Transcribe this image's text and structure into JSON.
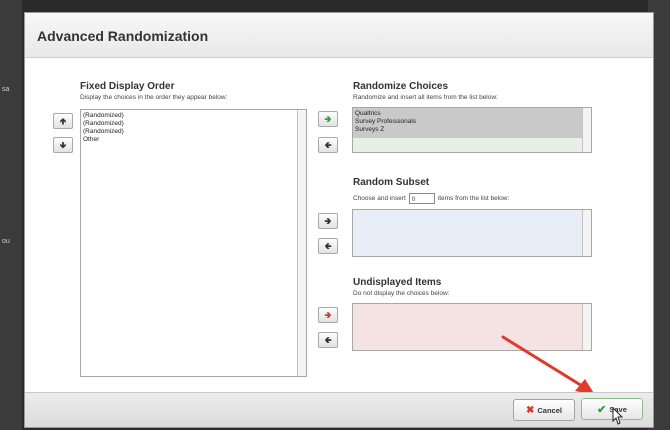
{
  "dialog": {
    "title": "Advanced Randomization"
  },
  "fixed": {
    "title": "Fixed Display Order",
    "description": "Display the choices in the order they appear below:",
    "items": [
      "(Randomized)",
      "(Randomized)",
      "(Randomized)",
      "Other"
    ]
  },
  "randomize": {
    "title": "Randomize Choices",
    "description": "Randomize and insert all items from the list below:",
    "items": [
      "Qualtrics",
      "Survey Professionals",
      "Surveys Z"
    ]
  },
  "subset": {
    "title": "Random Subset",
    "description_prefix": "Choose and insert",
    "count_value": "0",
    "description_suffix": "items from the list below:"
  },
  "undisplayed": {
    "title": "Undisplayed Items",
    "description": "Do not display the choices below:"
  },
  "footer": {
    "cancel_label": "Cancel",
    "save_label": "Save"
  },
  "colors": {
    "selected_row": "#c9c9c9",
    "subset_bg": "#e9edf7",
    "undisplayed_bg": "#f5e3e3",
    "arrow_green": "#3c9a3c",
    "arrow_red": "#c04545",
    "cancel_red": "#d23a2a",
    "save_green": "#3d9a34",
    "annotation_arrow": "#e03a2a"
  },
  "icons": {
    "up": "arrow-up-icon",
    "down": "arrow-down-icon",
    "right": "arrow-right-icon",
    "left": "arrow-left-icon",
    "cancel": "x-icon",
    "save": "checkmark-icon"
  }
}
